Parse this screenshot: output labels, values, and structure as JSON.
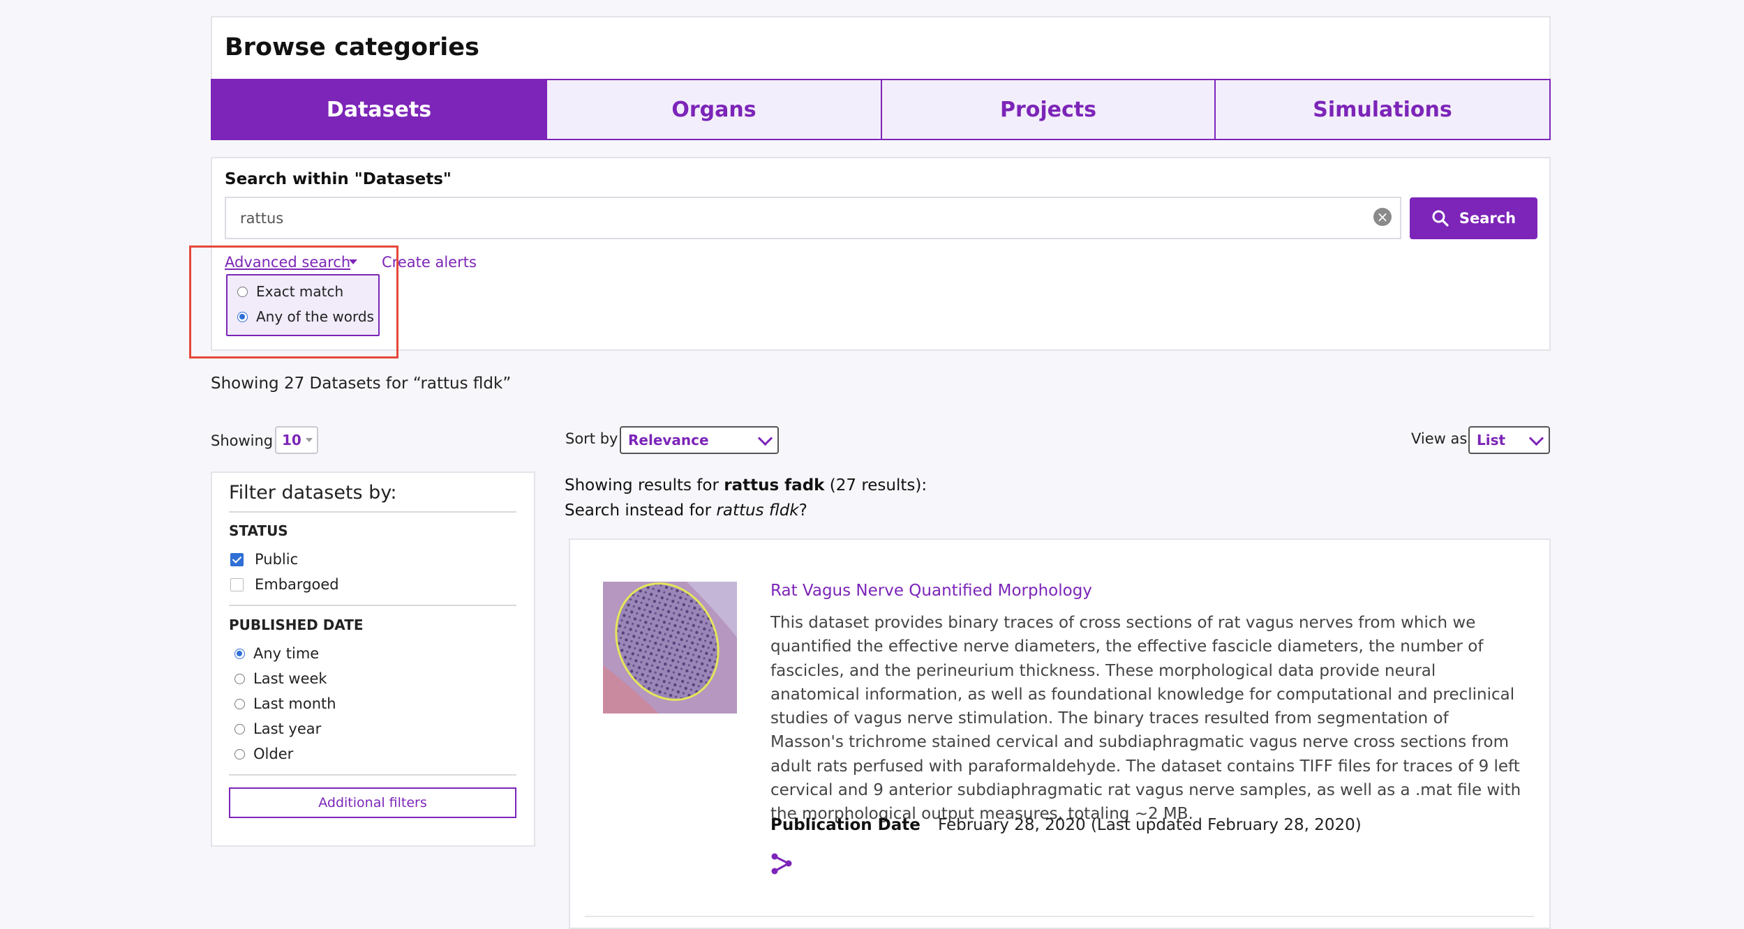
{
  "browse": {
    "title": "Browse categories",
    "tabs": [
      {
        "label": "Datasets",
        "active": true
      },
      {
        "label": "Organs",
        "active": false
      },
      {
        "label": "Projects",
        "active": false
      },
      {
        "label": "Simulations",
        "active": false
      }
    ]
  },
  "search": {
    "label": "Search within \"Datasets\"",
    "value": "rattus",
    "button_label": "Search",
    "advanced_label": "Advanced search",
    "alerts_label": "Create alerts",
    "options": [
      {
        "label": "Exact match",
        "selected": false
      },
      {
        "label": "Any of the words",
        "selected": true
      }
    ]
  },
  "summary": "Showing 27 Datasets for “rattus fldk”",
  "controls": {
    "showing_label": "Showing",
    "page_size": "10",
    "sort_label": "Sort by",
    "sort_value": "Relevance",
    "view_label": "View as",
    "view_value": "List"
  },
  "filters": {
    "title": "Filter datasets by:",
    "status_title": "STATUS",
    "status_options": [
      {
        "label": "Public",
        "checked": true
      },
      {
        "label": "Embargoed",
        "checked": false
      }
    ],
    "date_title": "PUBLISHED DATE",
    "date_options": [
      {
        "label": "Any time",
        "selected": true
      },
      {
        "label": "Last week",
        "selected": false
      },
      {
        "label": "Last month",
        "selected": false
      },
      {
        "label": "Last year",
        "selected": false
      },
      {
        "label": "Older",
        "selected": false
      }
    ],
    "additional_label": "Additional filters"
  },
  "results": {
    "showing_prefix": "Showing results for ",
    "showing_term": "rattus fadk",
    "showing_suffix": " (27 results):",
    "instead_prefix": "Search instead for ",
    "instead_term": "rattus fldk",
    "instead_suffix": "?",
    "item": {
      "title": "Rat Vagus Nerve Quantified Morphology",
      "description": "This dataset provides binary traces of cross sections of rat vagus nerves from which we quantified the effective nerve diameters, the effective fascicle diameters, the number of fascicles, and the perineurium thickness. These morphological data provide neural anatomical information, as well as foundational knowledge for computational and preclinical studies of vagus nerve stimulation. The binary traces resulted from segmentation of Masson's trichrome stained cervical and subdiaphragmatic vagus nerve cross sections from adult rats perfused with paraformaldehyde. The dataset contains TIFF files for traces of 9 left cervical and 9 anterior subdiaphragmatic rat vagus nerve samples, as well as a .mat file with the morphological output measures, totaling ~2 MB.",
      "pubdate_label": "Publication Date",
      "pubdate_value": "February 28, 2020 (Last updated February 28, 2020)",
      "share_icon": "share-icon"
    }
  },
  "colors": {
    "accent": "#7c25b8",
    "highlight": "#e5483a",
    "check": "#2f6fd6"
  }
}
